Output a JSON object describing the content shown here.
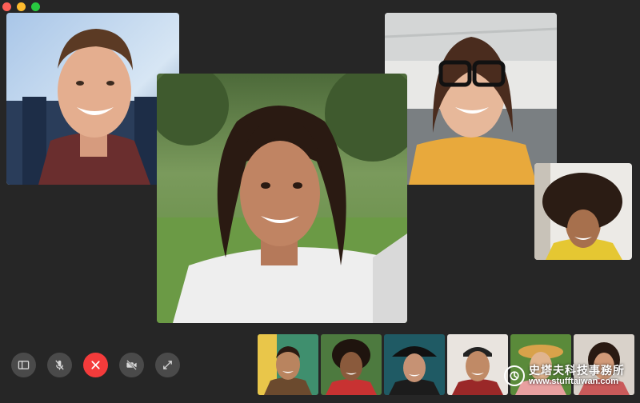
{
  "window": {
    "close_color": "#fe5f57",
    "minimize_color": "#febc2e",
    "maximize_color": "#28c840"
  },
  "participants": [
    {
      "role": "participant",
      "position": "top-left",
      "background": "sky-blue"
    },
    {
      "role": "active-speaker",
      "position": "center",
      "background": "garden-green"
    },
    {
      "role": "participant",
      "position": "top-right",
      "background": "office-white"
    },
    {
      "role": "participant",
      "position": "right",
      "background": "bright-white"
    }
  ],
  "controls": [
    {
      "name": "sidebar-toggle",
      "icon": "sidebar-icon"
    },
    {
      "name": "mute",
      "icon": "microphone-slash-icon"
    },
    {
      "name": "end-call",
      "icon": "close-icon",
      "color": "#f43b3b"
    },
    {
      "name": "camera-off",
      "icon": "video-slash-icon"
    },
    {
      "name": "fullscreen",
      "icon": "expand-icon"
    }
  ],
  "thumbnails_count": 6,
  "watermark": {
    "title": "史塔夫科技事務所",
    "url": "www.stufftaiwan.com"
  }
}
